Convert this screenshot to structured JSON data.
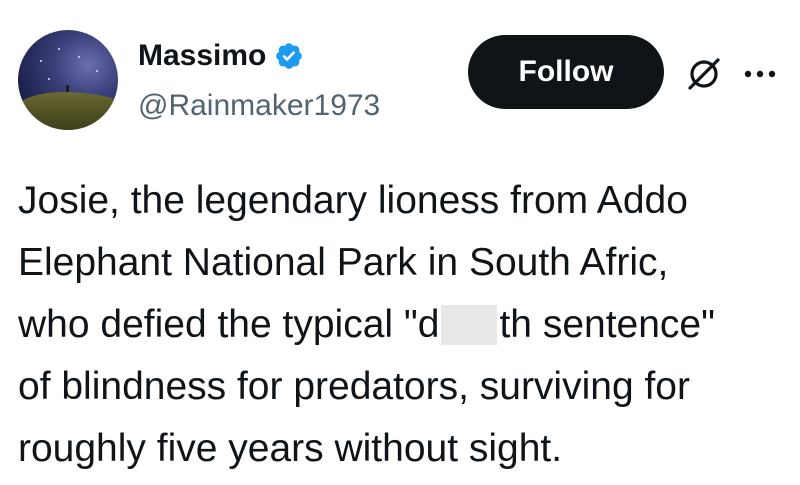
{
  "author": {
    "display_name": "Massimo",
    "handle": "@Rainmaker1973",
    "verified": true,
    "verified_color": "#1d9bf0"
  },
  "actions": {
    "follow_label": "Follow",
    "follow_bg": "#0f1419",
    "grok_icon": "grok-icon",
    "more_icon": "more-options-icon"
  },
  "tweet": {
    "line1": "Josie, the legendary lioness from Addo",
    "line2": "Elephant National Park in South Afric,",
    "line3_before": "who defied the typical \"d",
    "line3_after": "th sentence\"",
    "line4": "of blindness for predators, surviving for",
    "line5": "roughly five years without sight."
  },
  "colors": {
    "text_primary": "#0f1419",
    "text_secondary": "#536471",
    "background": "#ffffff"
  }
}
